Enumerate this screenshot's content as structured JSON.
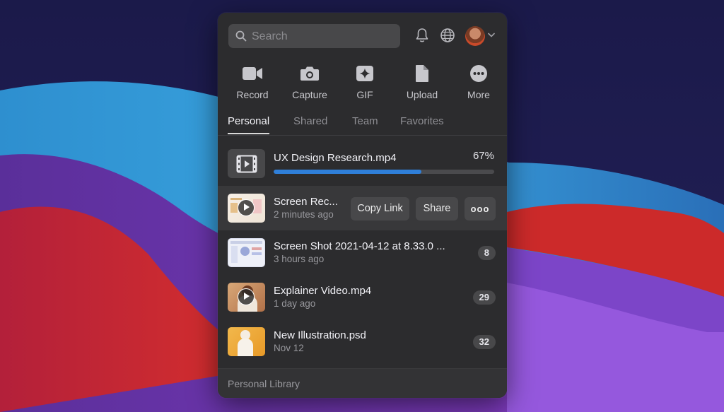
{
  "search": {
    "placeholder": "Search"
  },
  "header_icons": [
    "bell-icon",
    "globe-icon",
    "avatar",
    "chevron-down-icon"
  ],
  "actions": [
    {
      "label": "Record",
      "icon": "video-camera-icon"
    },
    {
      "label": "Capture",
      "icon": "camera-icon"
    },
    {
      "label": "GIF",
      "icon": "sparkle-icon"
    },
    {
      "label": "Upload",
      "icon": "document-icon"
    },
    {
      "label": "More",
      "icon": "more-icon"
    }
  ],
  "tabs": [
    {
      "label": "Personal",
      "active": true
    },
    {
      "label": "Shared"
    },
    {
      "label": "Team"
    },
    {
      "label": "Favorites"
    }
  ],
  "upload": {
    "name": "UX Design Research.mp4",
    "percent_label": "67%",
    "progress": 0.67,
    "icon": "film-icon"
  },
  "items": [
    {
      "title": "Screen Rec...",
      "subtitle": "2 minutes ago",
      "type": "video",
      "actions": {
        "copy_link": "Copy Link",
        "share": "Share",
        "more": "ooo"
      }
    },
    {
      "title": "Screen Shot 2021-04-12 at 8.33.0 ...",
      "subtitle": "3 hours ago",
      "type": "image",
      "count": "8"
    },
    {
      "title": "Explainer Video.mp4",
      "subtitle": "1 day ago",
      "type": "video",
      "count": "29"
    },
    {
      "title": "New Illustration.psd",
      "subtitle": "Nov 12",
      "type": "image",
      "count": "32"
    }
  ],
  "footer": {
    "label": "Personal Library"
  },
  "colors": {
    "accent": "#2f7fd9",
    "panel": "#2c2c2e"
  }
}
